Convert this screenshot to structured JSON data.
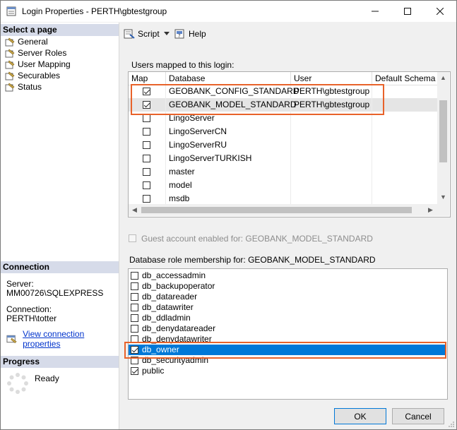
{
  "window": {
    "title": "Login Properties - PERTH\\gbtestgroup"
  },
  "left_panel": {
    "select_page_header": "Select a page",
    "pages": [
      {
        "label": "General",
        "icon": "wrench-page-icon"
      },
      {
        "label": "Server Roles",
        "icon": "wrench-page-icon"
      },
      {
        "label": "User Mapping",
        "icon": "wrench-page-icon"
      },
      {
        "label": "Securables",
        "icon": "wrench-page-icon"
      },
      {
        "label": "Status",
        "icon": "wrench-page-icon"
      }
    ],
    "connection_header": "Connection",
    "server_label": "Server:",
    "server_value": "MM00726\\SQLEXPRESS",
    "connection_label": "Connection:",
    "connection_value": "PERTH\\totter",
    "view_connection_link": "View connection properties",
    "progress_header": "Progress",
    "progress_status": "Ready"
  },
  "toolbar": {
    "script_label": "Script",
    "help_label": "Help"
  },
  "users_mapped": {
    "label": "Users mapped to this login:",
    "columns": [
      "Map",
      "Database",
      "User",
      "Default Schema"
    ],
    "rows": [
      {
        "map": true,
        "database": "GEOBANK_CONFIG_STANDARD",
        "user": "PERTH\\gbtestgroup",
        "schema": ""
      },
      {
        "map": true,
        "database": "GEOBANK_MODEL_STANDARD",
        "user": "PERTH\\gbtestgroup",
        "schema": ""
      },
      {
        "map": false,
        "database": "LingoServer",
        "user": "",
        "schema": ""
      },
      {
        "map": false,
        "database": "LingoServerCN",
        "user": "",
        "schema": ""
      },
      {
        "map": false,
        "database": "LingoServerRU",
        "user": "",
        "schema": ""
      },
      {
        "map": false,
        "database": "LingoServerTURKISH",
        "user": "",
        "schema": ""
      },
      {
        "map": false,
        "database": "master",
        "user": "",
        "schema": ""
      },
      {
        "map": false,
        "database": "model",
        "user": "",
        "schema": ""
      },
      {
        "map": false,
        "database": "msdb",
        "user": "",
        "schema": ""
      }
    ]
  },
  "guest_account": {
    "label": "Guest account enabled for: GEOBANK_MODEL_STANDARD",
    "checked": false
  },
  "role_membership": {
    "label": "Database role membership for: GEOBANK_MODEL_STANDARD",
    "roles": [
      {
        "name": "db_accessadmin",
        "checked": false
      },
      {
        "name": "db_backupoperator",
        "checked": false
      },
      {
        "name": "db_datareader",
        "checked": false
      },
      {
        "name": "db_datawriter",
        "checked": false
      },
      {
        "name": "db_ddladmin",
        "checked": false
      },
      {
        "name": "db_denydatareader",
        "checked": false
      },
      {
        "name": "db_denydatawriter",
        "checked": false
      },
      {
        "name": "db_owner",
        "checked": true
      },
      {
        "name": "db_securityadmin",
        "checked": false
      },
      {
        "name": "public",
        "checked": true
      }
    ]
  },
  "buttons": {
    "ok": "OK",
    "cancel": "Cancel"
  }
}
